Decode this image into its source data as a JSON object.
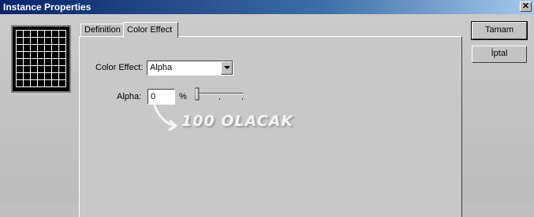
{
  "window": {
    "title": "Instance Properties",
    "close_icon": "close-icon"
  },
  "tabs": [
    {
      "label": "Definition",
      "active": false
    },
    {
      "label": "Color Effect",
      "active": true
    }
  ],
  "color_effect": {
    "label": "Color Effect:",
    "selected": "Alpha",
    "alpha_label": "Alpha:",
    "alpha_value": "0",
    "percent": "%",
    "slider_value_percent": 0
  },
  "buttons": {
    "ok": "Tamam",
    "cancel": "İptal"
  },
  "annotation": {
    "text": "100 OLACAK"
  }
}
